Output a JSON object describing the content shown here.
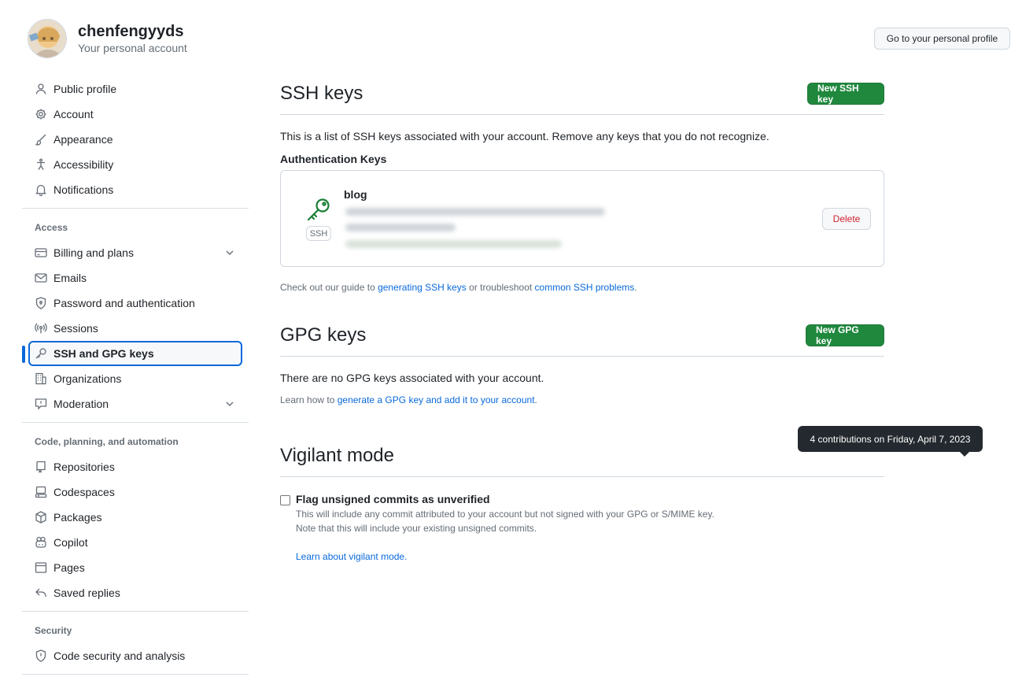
{
  "user": {
    "name": "chenfengyyds",
    "subtitle": "Your personal account"
  },
  "header": {
    "profile_button": "Go to your personal profile"
  },
  "sidebar": {
    "items_top": [
      {
        "label": "Public profile",
        "icon": "person-icon"
      },
      {
        "label": "Account",
        "icon": "gear-icon"
      },
      {
        "label": "Appearance",
        "icon": "paintbrush-icon"
      },
      {
        "label": "Accessibility",
        "icon": "accessibility-icon"
      },
      {
        "label": "Notifications",
        "icon": "bell-icon"
      }
    ],
    "access_title": "Access",
    "items_access": [
      {
        "label": "Billing and plans",
        "icon": "credit-card-icon"
      },
      {
        "label": "Emails",
        "icon": "mail-icon"
      },
      {
        "label": "Password and authentication",
        "icon": "shield-lock-icon"
      },
      {
        "label": "Sessions",
        "icon": "broadcast-icon"
      },
      {
        "label": "SSH and GPG keys",
        "icon": "key-icon"
      },
      {
        "label": "Organizations",
        "icon": "organization-icon"
      },
      {
        "label": "Moderation",
        "icon": "report-icon"
      }
    ],
    "code_title": "Code, planning, and automation",
    "items_code": [
      {
        "label": "Repositories",
        "icon": "repo-icon"
      },
      {
        "label": "Codespaces",
        "icon": "codespaces-icon"
      },
      {
        "label": "Packages",
        "icon": "package-icon"
      },
      {
        "label": "Copilot",
        "icon": "copilot-icon"
      },
      {
        "label": "Pages",
        "icon": "browser-icon"
      },
      {
        "label": "Saved replies",
        "icon": "reply-icon"
      }
    ],
    "security_title": "Security",
    "items_security": [
      {
        "label": "Code security and analysis",
        "icon": "shield-icon"
      }
    ]
  },
  "ssh": {
    "title": "SSH keys",
    "new_button": "New SSH key",
    "description": "This is a list of SSH keys associated with your account. Remove any keys that you do not recognize.",
    "auth_title": "Authentication Keys",
    "key_name": "blog",
    "key_badge": "SSH",
    "delete_button": "Delete",
    "guide_prefix": "Check out our guide to ",
    "guide_link1": "generating SSH keys",
    "guide_middle": " or troubleshoot ",
    "guide_link2": "common SSH problems",
    "guide_suffix": "."
  },
  "gpg": {
    "title": "GPG keys",
    "new_button": "New GPG key",
    "empty": "There are no GPG keys associated with your account.",
    "learn_prefix": "Learn how to ",
    "learn_link": "generate a GPG key and add it to your account",
    "learn_suffix": "."
  },
  "vigilant": {
    "title": "Vigilant mode",
    "checkbox_label": "Flag unsigned commits as unverified",
    "desc1": "This will include any commit attributed to your account but not signed with your GPG or S/MIME key.",
    "desc2": "Note that this will include your existing unsigned commits.",
    "learn_link": "Learn about vigilant mode."
  },
  "tooltip": "4 contributions on Friday, April 7, 2023",
  "colors": {
    "accent": "#0969da",
    "green": "#1f883d",
    "danger": "#cf222e"
  }
}
